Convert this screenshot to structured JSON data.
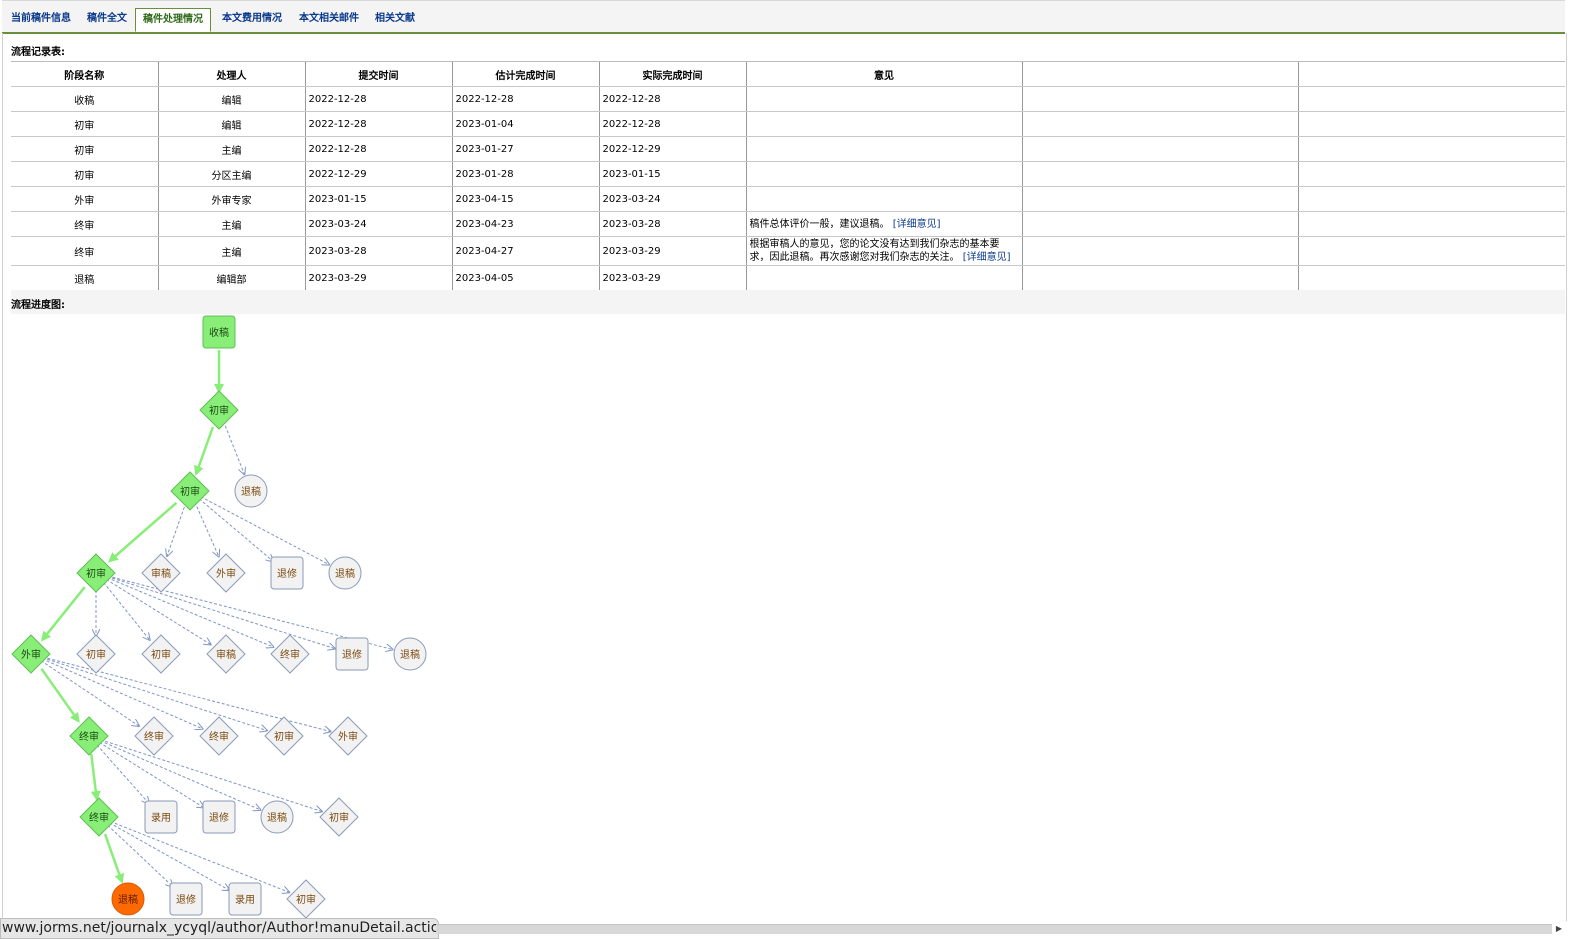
{
  "tabs": [
    {
      "label": "当前稿件信息",
      "active": false
    },
    {
      "label": "稿件全文",
      "active": false
    },
    {
      "label": "稿件处理情况",
      "active": true
    },
    {
      "label": "本文费用情况",
      "active": false
    },
    {
      "label": "本文相关邮件",
      "active": false
    },
    {
      "label": "相关文献",
      "active": false
    }
  ],
  "record_title": "流程记录表:",
  "progress_title": "流程进度图:",
  "table": {
    "headers": [
      "阶段名称",
      "处理人",
      "提交时间",
      "估计完成时间",
      "实际完成时间",
      "意见",
      "",
      ""
    ],
    "rows": [
      {
        "stage": "收稿",
        "handler": "编辑",
        "submit": "2022-12-28",
        "estimate": "2022-12-28",
        "actual": "2022-12-28",
        "opinion": "",
        "link": ""
      },
      {
        "stage": "初审",
        "handler": "编辑",
        "submit": "2022-12-28",
        "estimate": "2023-01-04",
        "actual": "2022-12-28",
        "opinion": "",
        "link": ""
      },
      {
        "stage": "初审",
        "handler": "主编",
        "submit": "2022-12-28",
        "estimate": "2023-01-27",
        "actual": "2022-12-29",
        "opinion": "",
        "link": ""
      },
      {
        "stage": "初审",
        "handler": "分区主编",
        "submit": "2022-12-29",
        "estimate": "2023-01-28",
        "actual": "2023-01-15",
        "opinion": "",
        "link": ""
      },
      {
        "stage": "外审",
        "handler": "外审专家",
        "submit": "2023-01-15",
        "estimate": "2023-04-15",
        "actual": "2023-03-24",
        "opinion": "",
        "link": ""
      },
      {
        "stage": "终审",
        "handler": "主编",
        "submit": "2023-03-24",
        "estimate": "2023-04-23",
        "actual": "2023-03-28",
        "opinion": " 稿件总体评价一般，建议退稿。",
        "link": "[详细意见]"
      },
      {
        "stage": "终审",
        "handler": "主编",
        "submit": "2023-03-28",
        "estimate": "2023-04-27",
        "actual": "2023-03-29",
        "opinion": " 根据审稿人的意见，您的论文没有达到我们杂志的基本要求，因此退稿。再次感谢您对我们杂志的关注。",
        "link": "[详细意见]"
      },
      {
        "stage": "退稿",
        "handler": "编辑部",
        "submit": "2023-03-29",
        "estimate": "2023-04-05",
        "actual": "2023-03-29",
        "opinion": "",
        "link": ""
      }
    ]
  },
  "flow_nodes": {
    "n0": "收稿",
    "n1": "初审",
    "n1a": "退稿",
    "n2": "初审",
    "n2a": "审稿",
    "n2b": "外审",
    "n2c": "退修",
    "n2d": "退稿",
    "n3": "初审",
    "n3a": "初审",
    "n3b": "初审",
    "n3c": "审稿",
    "n3d": "终审",
    "n3e": "退修",
    "n3f": "退稿",
    "n4": "外审",
    "n4a": "终审",
    "n4b": "终审",
    "n4c": "初审",
    "n4d": "外审",
    "n5": "终审",
    "n5a": "录用",
    "n5b": "退修",
    "n5c": "退稿",
    "n5d": "初审",
    "n6": "终审",
    "n6a": "退修",
    "n6b": "录用",
    "n6c": "初审",
    "n7": "退稿"
  },
  "colors": {
    "active_fill": "#88ee77",
    "active_edge": "#88ee77",
    "inactive_fill": "#f2f2f2",
    "inactive_stroke": "#8a9ab8",
    "dashed_edge": "#7f95c4",
    "final_fill": "#ff6a00",
    "tab_text": "#0b3a8c",
    "tab_active_text": "#2f6b1a",
    "tab_underline": "#6b8e3d"
  },
  "status_url": "www.jorms.net/journalx_ycyql/author/Author!manuDetail.action#"
}
